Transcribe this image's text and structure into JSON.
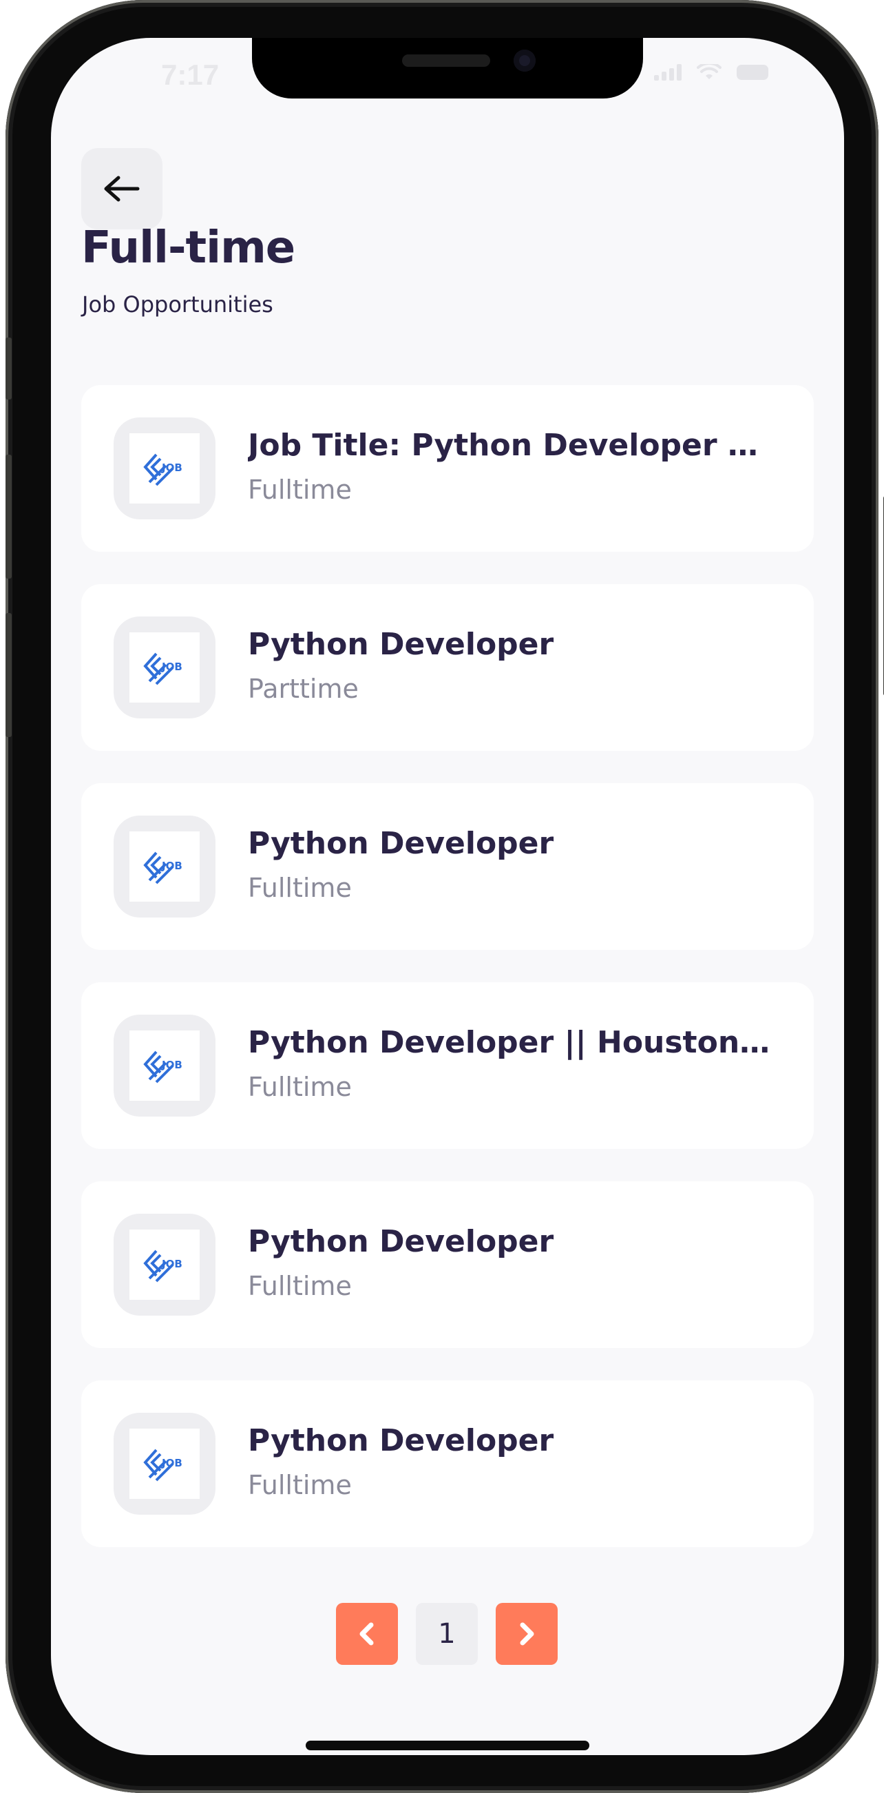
{
  "status_bar": {
    "time": "7:17"
  },
  "header": {
    "back_icon": "arrow-left-icon",
    "title": "Full-time",
    "subtitle": "Job Opportunities"
  },
  "jobs": [
    {
      "title": "Job Title: Python Developer Lo...",
      "type": "Fulltime",
      "logo_icon": "job-logo-icon"
    },
    {
      "title": "Python Developer",
      "type": "Parttime",
      "logo_icon": "job-logo-icon"
    },
    {
      "title": "Python Developer",
      "type": "Fulltime",
      "logo_icon": "job-logo-icon"
    },
    {
      "title": "Python Developer || Houston, T...",
      "type": "Fulltime",
      "logo_icon": "job-logo-icon"
    },
    {
      "title": "Python Developer",
      "type": "Fulltime",
      "logo_icon": "job-logo-icon"
    },
    {
      "title": "Python Developer",
      "type": "Fulltime",
      "logo_icon": "job-logo-icon"
    }
  ],
  "pagination": {
    "prev_icon": "chevron-left-icon",
    "current_page": "1",
    "next_icon": "chevron-right-icon"
  },
  "colors": {
    "primary_text": "#2a2346",
    "secondary_text": "#8a8a99",
    "accent": "#ff7b5a",
    "logo_blue": "#2f6fd9",
    "background": "#f8f8fa"
  }
}
